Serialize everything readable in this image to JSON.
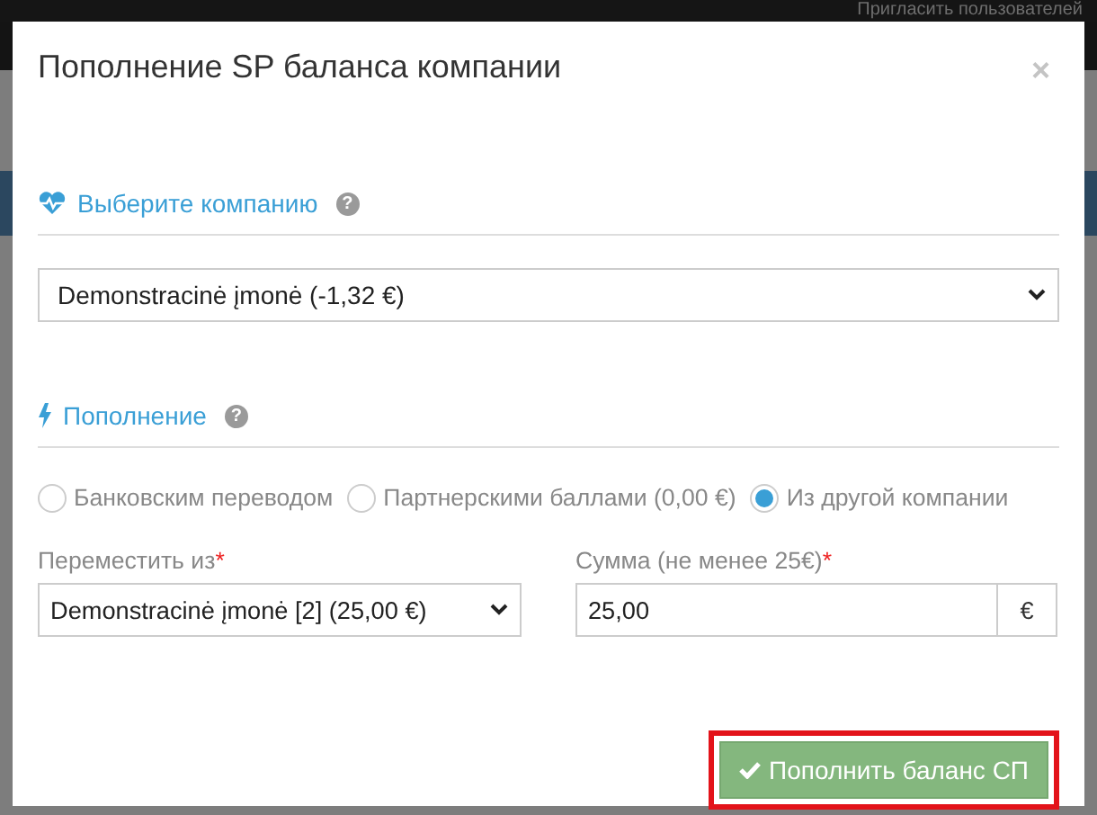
{
  "background": {
    "top_bar_link": "Пригласить пользователей"
  },
  "modal": {
    "title": "Пополнение SP баланса компании",
    "close": "×"
  },
  "company_section": {
    "title": "Выберите компанию",
    "help": "?",
    "selected_company": "Demonstracinė įmonė (-1,32 €)"
  },
  "topup_section": {
    "title": "Пополнение",
    "help": "?",
    "methods": [
      {
        "label": "Банковским переводом",
        "selected": false
      },
      {
        "label": "Партнерскими баллами (0,00 €)",
        "selected": false
      },
      {
        "label": "Из другой компании",
        "selected": true
      }
    ],
    "from_field": {
      "label": "Переместить из",
      "required_mark": "*",
      "value": "Demonstracinė įmonė [2] (25,00 €)"
    },
    "amount_field": {
      "label": "Сумма (не менее 25€)",
      "required_mark": "*",
      "value": "25,00",
      "unit": "€"
    }
  },
  "submit_button": {
    "label": "Пополнить баланс СП",
    "highlighted": true
  }
}
